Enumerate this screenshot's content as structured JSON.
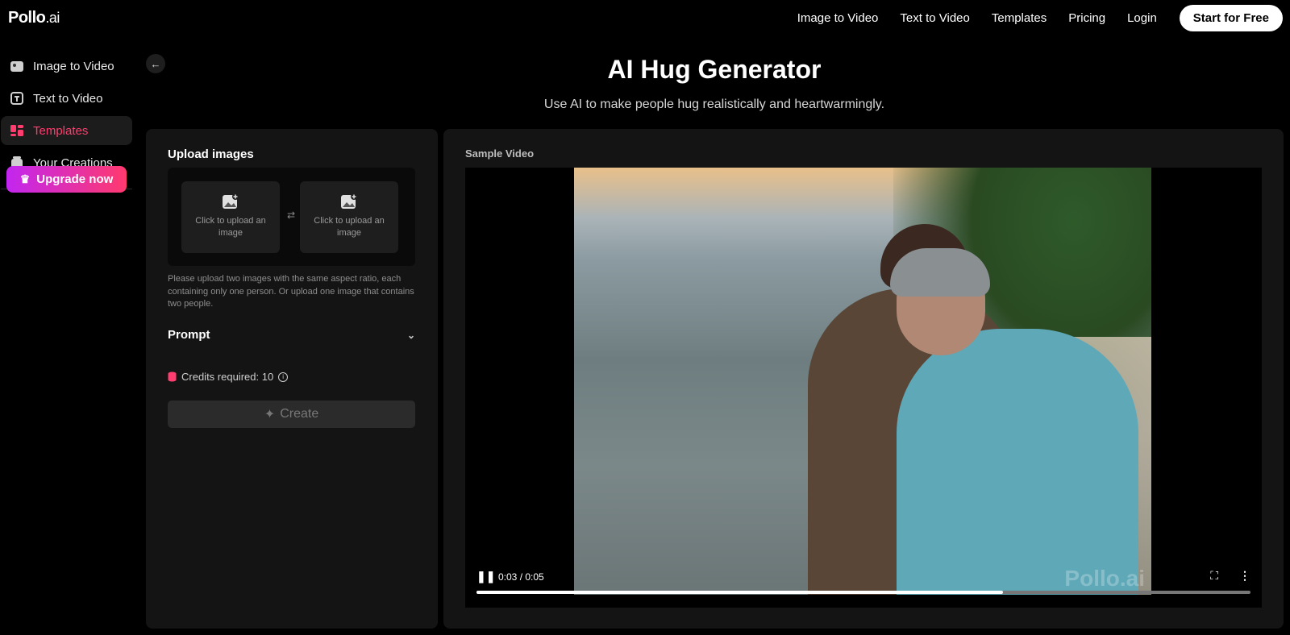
{
  "brand": {
    "name": "Pollo",
    "suffix": ".ai"
  },
  "nav": {
    "links": [
      "Image to Video",
      "Text to Video",
      "Templates",
      "Pricing",
      "Login"
    ],
    "cta": "Start for Free"
  },
  "sidebar": {
    "items": [
      {
        "label": "Image to Video",
        "icon": "image-to-video-icon",
        "active": false
      },
      {
        "label": "Text to Video",
        "icon": "text-to-video-icon",
        "active": false
      },
      {
        "label": "Templates",
        "icon": "templates-icon",
        "active": true
      },
      {
        "label": "Your Creations",
        "icon": "creations-icon",
        "active": false
      }
    ],
    "upgrade_label": "Upgrade now"
  },
  "page": {
    "title": "AI Hug Generator",
    "subtitle": "Use AI to make people hug realistically and heartwarmingly."
  },
  "upload": {
    "heading": "Upload images",
    "slot_label": "Click to upload an image",
    "hint": "Please upload two images with the same aspect ratio, each containing only one person. Or upload one image that contains two people."
  },
  "prompt": {
    "label": "Prompt"
  },
  "credits": {
    "text": "Credits required: 10"
  },
  "create": {
    "label": "Create"
  },
  "sample": {
    "heading": "Sample Video",
    "time": "0:03 / 0:05",
    "progress": 0.68,
    "watermark": "Pollo.ai"
  },
  "colors": {
    "accent": "#ff3d6e",
    "panel": "#141414",
    "upgrade_start": "#c226f0",
    "upgrade_end": "#ff3a6e"
  }
}
